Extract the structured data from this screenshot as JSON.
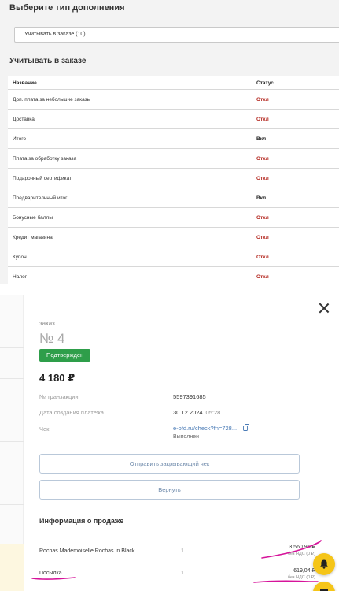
{
  "admin": {
    "heading": "Выберите тип дополнения",
    "select_value": "Учитывать в заказе (10)",
    "section_title": "Учитывать в заказе",
    "columns": [
      "Название",
      "Статус"
    ],
    "rows": [
      {
        "name": "Доп. плата за небольшие заказы",
        "status": "Откл"
      },
      {
        "name": "Доставка",
        "status": "Откл"
      },
      {
        "name": "Итого",
        "status": "Вкл"
      },
      {
        "name": "Плата за обработку заказа",
        "status": "Откл"
      },
      {
        "name": "Подарочный сертификат",
        "status": "Откл"
      },
      {
        "name": "Предварительный итог",
        "status": "Вкл"
      },
      {
        "name": "Бонусные баллы",
        "status": "Откл"
      },
      {
        "name": "Кредит магазина",
        "status": "Откл"
      },
      {
        "name": "Купон",
        "status": "Откл"
      },
      {
        "name": "Налог",
        "status": "Откл"
      }
    ],
    "colors": {
      "off": "#b3261e",
      "on": "#222222"
    }
  },
  "modal": {
    "order_label": "заказ",
    "order_number": "№ 4",
    "status_badge": "Подтвержден",
    "amount": "4 180 ₽",
    "transaction_label": "№ транзакции",
    "transaction_value": "5597391685",
    "created_label": "Дата создания платежа",
    "created_date": "30.12.2024",
    "created_time": "05:28",
    "receipt_label": "Чек",
    "receipt_link": "e-ofd.ru/check?fn=728...",
    "receipt_status": "Выполнен",
    "send_button": "Отправить закрывающий чек",
    "refund_button": "Вернуть",
    "sale_info_title": "Информация о продаже",
    "items": [
      {
        "name": "Rochas Mademoiselle Rochas In Black",
        "qty": "1",
        "price": "3 560,96 ₽",
        "vat": "без НДС (0 ₽)"
      },
      {
        "name": "Посылка",
        "qty": "1",
        "price": "619,04 ₽",
        "vat": "без НДС (0 ₽)"
      }
    ],
    "icons": [
      "close-icon",
      "copy-icon",
      "bell-icon",
      "chat-icon"
    ],
    "colors": {
      "badge": "#2e9e4a",
      "link": "#4a7bb6",
      "fab": "#f5c518",
      "annotation": "#d6139a"
    }
  }
}
